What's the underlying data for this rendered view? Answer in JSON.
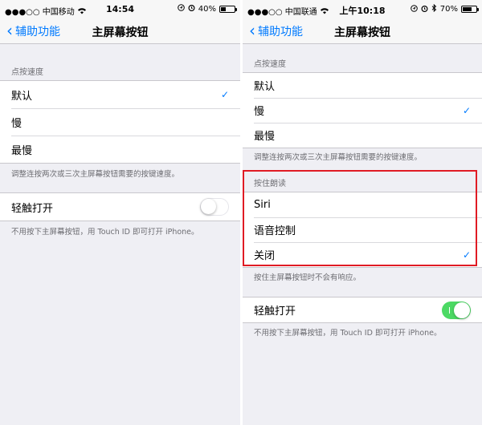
{
  "colors": {
    "accent": "#007aff",
    "toggle_on": "#4cd964",
    "highlight": "#e01b24"
  },
  "left": {
    "status": {
      "carrier": "●●●○○ 中国移动",
      "time": "14:54",
      "battery": "40%",
      "battery_level": 0.4
    },
    "nav": {
      "back": "辅助功能",
      "title": "主屏幕按钮"
    },
    "speed": {
      "header": "点按速度",
      "items": [
        {
          "label": "默认",
          "checked": true
        },
        {
          "label": "慢",
          "checked": false
        },
        {
          "label": "最慢",
          "checked": false
        }
      ],
      "footer": "调整连按两次或三次主屏幕按钮需要的按键速度。"
    },
    "rest": {
      "label": "轻触打开",
      "on": false,
      "footer": "不用按下主屏幕按钮，用 Touch ID 即可打开 iPhone。"
    }
  },
  "right": {
    "status": {
      "carrier": "●●●○○ 中国联通",
      "time": "上午10:18",
      "battery": "70%",
      "battery_level": 0.7
    },
    "nav": {
      "back": "辅助功能",
      "title": "主屏幕按钮"
    },
    "speed": {
      "header": "点按速度",
      "items": [
        {
          "label": "默认",
          "checked": false
        },
        {
          "label": "慢",
          "checked": true
        },
        {
          "label": "最慢",
          "checked": false
        }
      ],
      "footer": "调整连按两次或三次主屏幕按钮需要的按键速度。"
    },
    "hold": {
      "header": "按住朗读",
      "items": [
        {
          "label": "Siri",
          "checked": false
        },
        {
          "label": "语音控制",
          "checked": false
        },
        {
          "label": "关闭",
          "checked": true
        }
      ],
      "footer": "按住主屏幕按钮时不会有响应。"
    },
    "rest": {
      "label": "轻触打开",
      "on": true,
      "footer": "不用按下主屏幕按钮，用 Touch ID 即可打开 iPhone。"
    }
  }
}
